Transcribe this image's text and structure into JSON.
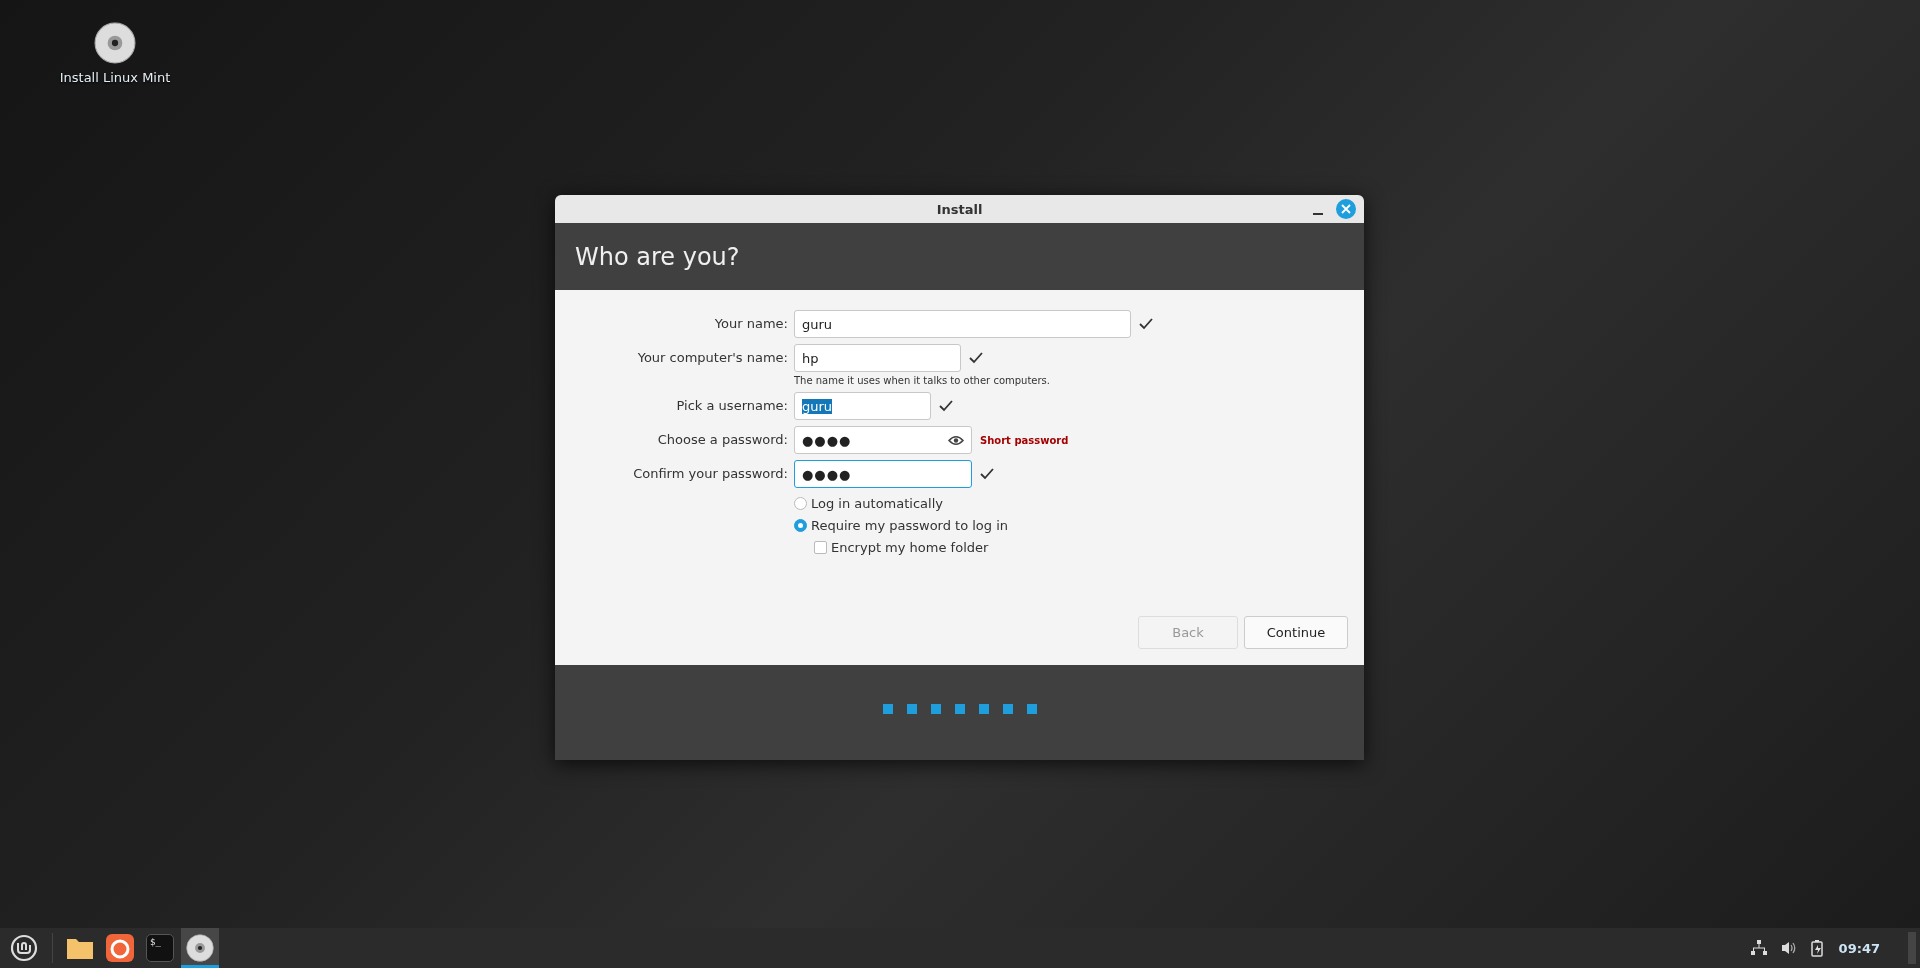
{
  "desktop_icons": [
    {
      "label": "Install Linux Mint"
    }
  ],
  "window": {
    "title": "Install",
    "heading": "Who are you?",
    "fields": [
      {
        "label": "Your name:",
        "value": "guru",
        "valid": true
      },
      {
        "label": "Your computer's name:",
        "value": "hp",
        "valid": true,
        "hint": "The name it uses when it talks to other computers."
      },
      {
        "label": "Pick a username:",
        "value": "guru",
        "valid": true,
        "value_selected": true
      },
      {
        "label": "Choose a password:",
        "value": "●●●●",
        "valid": false,
        "reveal_toggle": true,
        "message": "Short password"
      },
      {
        "label": "Confirm your password:",
        "value": "●●●●",
        "valid": true,
        "focused": true
      }
    ],
    "options": [
      {
        "kind": "radio",
        "label": "Log in automatically",
        "selected": false
      },
      {
        "kind": "radio",
        "label": "Require my password to log in",
        "selected": true
      },
      {
        "kind": "checkbox",
        "label": "Encrypt my home folder",
        "checked": false
      }
    ],
    "buttons": [
      {
        "label": "Back",
        "disabled": true
      },
      {
        "label": "Continue",
        "disabled": false
      }
    ],
    "progress_steps": [
      {
        "completed": true
      },
      {
        "completed": true
      },
      {
        "completed": true
      },
      {
        "completed": true
      },
      {
        "completed": true
      },
      {
        "completed": true
      },
      {
        "completed": true
      }
    ]
  },
  "taskbar": {
    "launchers": [
      {
        "kind": "files",
        "active": false
      },
      {
        "kind": "browser",
        "active": false
      },
      {
        "kind": "terminal",
        "text": "$_",
        "active": false
      },
      {
        "kind": "disc",
        "active": true
      }
    ],
    "clock": "09:47"
  }
}
